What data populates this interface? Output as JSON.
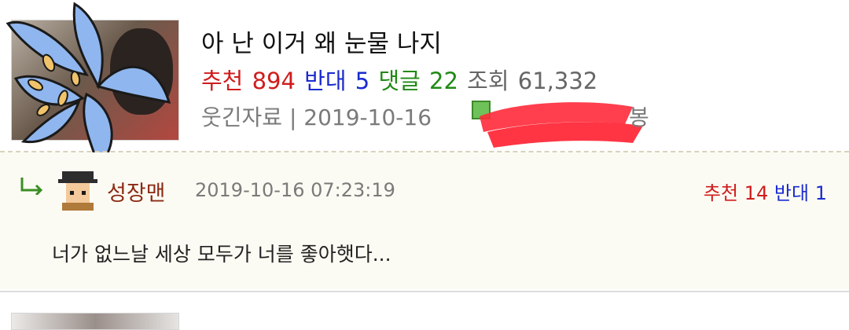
{
  "post": {
    "title": "아 난 이거 왜 눈물 나지",
    "recommend_label": "추천",
    "recommend_count": "894",
    "oppose_label": "반대",
    "oppose_count": "5",
    "comments_label": "댓글",
    "comments_count": "22",
    "views_label": "조회",
    "views_count": "61,332",
    "category": "웃긴자료",
    "separator": "|",
    "date": "2019-10-16",
    "author_tail": "봉"
  },
  "comment": {
    "nickname": "성장맨",
    "timestamp": "2019-10-16 07:23:19",
    "recommend_label": "추천",
    "recommend_count": "14",
    "oppose_label": "반대",
    "oppose_count": "1",
    "text": "너가 없느날 세상 모두가 너를 좋아햇다..."
  },
  "colors": {
    "recommend": "#d01c1c",
    "oppose": "#1a2bd0",
    "comments": "#1f8a14",
    "meta_gray": "#7a7a7a",
    "comment_bg": "#fcfbf3",
    "nickname": "#8b2a14"
  },
  "icons": {
    "thumbnail_overlay": "blue-lily-icon",
    "reply": "reply-arrow-icon",
    "avatar": "pixel-avatar-icon",
    "author_level": "level-badge-icon"
  }
}
